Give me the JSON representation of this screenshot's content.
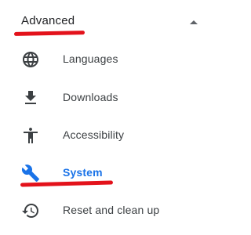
{
  "section": {
    "title": "Advanced",
    "collapse_icon": "arrow-drop-up-icon"
  },
  "menu": {
    "items": [
      {
        "label": "Languages",
        "icon": "globe-icon"
      },
      {
        "label": "Downloads",
        "icon": "download-icon"
      },
      {
        "label": "Accessibility",
        "icon": "accessibility-icon"
      },
      {
        "label": "System",
        "icon": "wrench-icon",
        "active": true
      },
      {
        "label": "Reset and clean up",
        "icon": "restore-icon"
      }
    ]
  },
  "colors": {
    "text": "#3c4043",
    "icon": "#3c4043",
    "active": "#1a73e8",
    "highlight_mark": "#e3121b"
  }
}
